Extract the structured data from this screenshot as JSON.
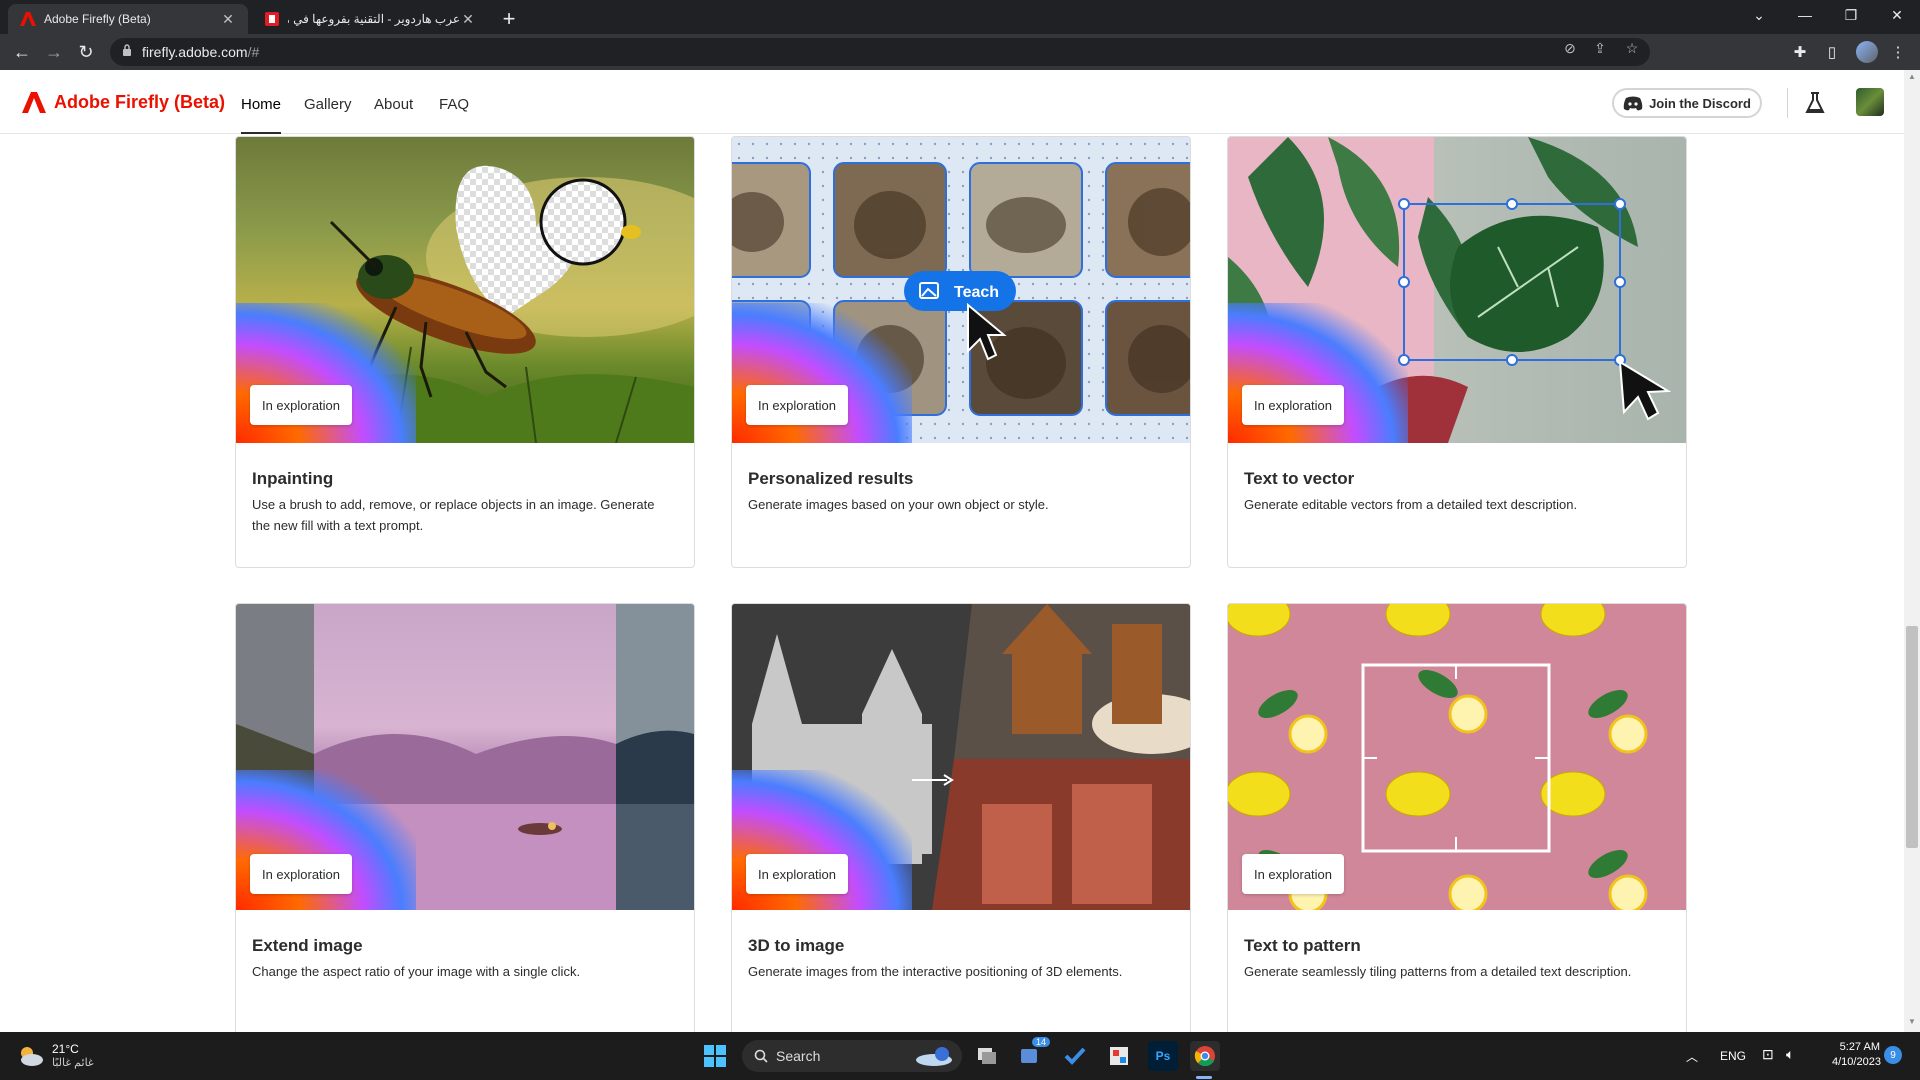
{
  "browser": {
    "tabs": [
      {
        "title": "Adobe Firefly (Beta)",
        "active": true
      },
      {
        "title": "عرب هاردوير - التقنية بفروعها في متناول الجميع",
        "active": false
      }
    ],
    "url_host": "firefly.adobe.com",
    "url_path": "/#"
  },
  "header": {
    "brand": "Adobe Firefly (Beta)",
    "nav": [
      {
        "label": "Home",
        "active": true
      },
      {
        "label": "Gallery",
        "active": false
      },
      {
        "label": "About",
        "active": false
      },
      {
        "label": "FAQ",
        "active": false
      }
    ],
    "discord_label": "Join the Discord"
  },
  "cards": [
    {
      "title": "Inpainting",
      "badge": "In exploration",
      "description": "Use a brush to add, remove, or replace objects in an image. Generate the new fill with a text prompt."
    },
    {
      "title": "Personalized results",
      "badge": "In exploration",
      "description": "Generate images based on your own object or style.",
      "teach_label": "Teach"
    },
    {
      "title": "Text to vector",
      "badge": "In exploration",
      "description": "Generate editable vectors from a detailed text description."
    },
    {
      "title": "Extend image",
      "badge": "In exploration",
      "description": "Change the aspect ratio of your image with a single click."
    },
    {
      "title": "3D to image",
      "badge": "In exploration",
      "description": "Generate images from the interactive positioning of 3D elements."
    },
    {
      "title": "Text to pattern",
      "badge": "In exploration",
      "description": "Generate seamlessly tiling patterns from a detailed text description."
    }
  ],
  "taskbar": {
    "weather_temp": "21°C",
    "weather_desc": "غائم غالبًا",
    "search_label": "Search",
    "todo_badge": "14",
    "lang": "ENG",
    "time": "5:27 AM",
    "date": "4/10/2023",
    "notif_count": "9"
  },
  "colors": {
    "adobe_red": "#eb1000",
    "chrome_dark": "#202124",
    "chrome_toolbar": "#35363a",
    "taskbar": "#1c1c1c"
  }
}
